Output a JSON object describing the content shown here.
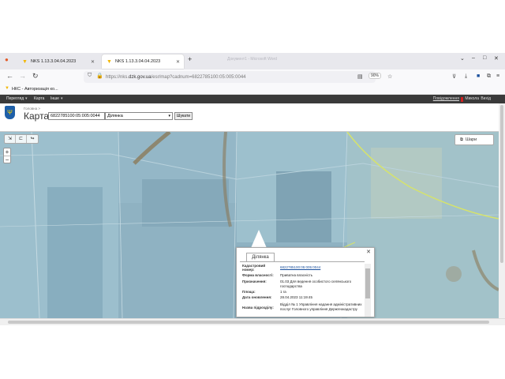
{
  "browser": {
    "tabs": [
      {
        "label": "NKS 1.13.3.04.04.2023",
        "active": false
      },
      {
        "label": "NKS 1.13.3.04.04.2023",
        "active": true
      }
    ],
    "ghost_title": "Документ1 - Microsoft Word",
    "url_prefix": "https://nks.",
    "url_domain": "dzk.gov.ua",
    "url_suffix": "/esr/map?cadnum=6822785100:05:005:0044",
    "zoom": "90%",
    "bookmark": "НКС - Авторизація ко..."
  },
  "app_menu": {
    "items": [
      "Перегляд",
      "Карта",
      "Інше"
    ],
    "right_links": [
      "Повідомлення",
      "Микола",
      "Вихід"
    ]
  },
  "header": {
    "breadcrumb": "Головна >",
    "title": "Карта",
    "cadnum_value": "6822785100:05:005:0044",
    "type_select": "Ділянка",
    "search_button": "Шукати"
  },
  "map": {
    "layers_button": "Шари"
  },
  "popup": {
    "tab_label": "Ділянка",
    "rows": [
      {
        "key": "Кадастровий номер:",
        "value": "6822785100:05:005:0044"
      },
      {
        "key": "Форма власності:",
        "value": "Приватна власність"
      },
      {
        "key": "Призначення:",
        "value": "01.03 Для ведення особистого селянського господарства"
      },
      {
        "key": "Площа:",
        "value": "1 га"
      },
      {
        "key": "Дата оновлення:",
        "value": "28.04.2023 11:19:45"
      },
      {
        "key": "Назва підрозділу:",
        "value": "Відділ № 1 Управління надання адміністративних послуг Головного управління Держгеокадастру"
      }
    ]
  }
}
